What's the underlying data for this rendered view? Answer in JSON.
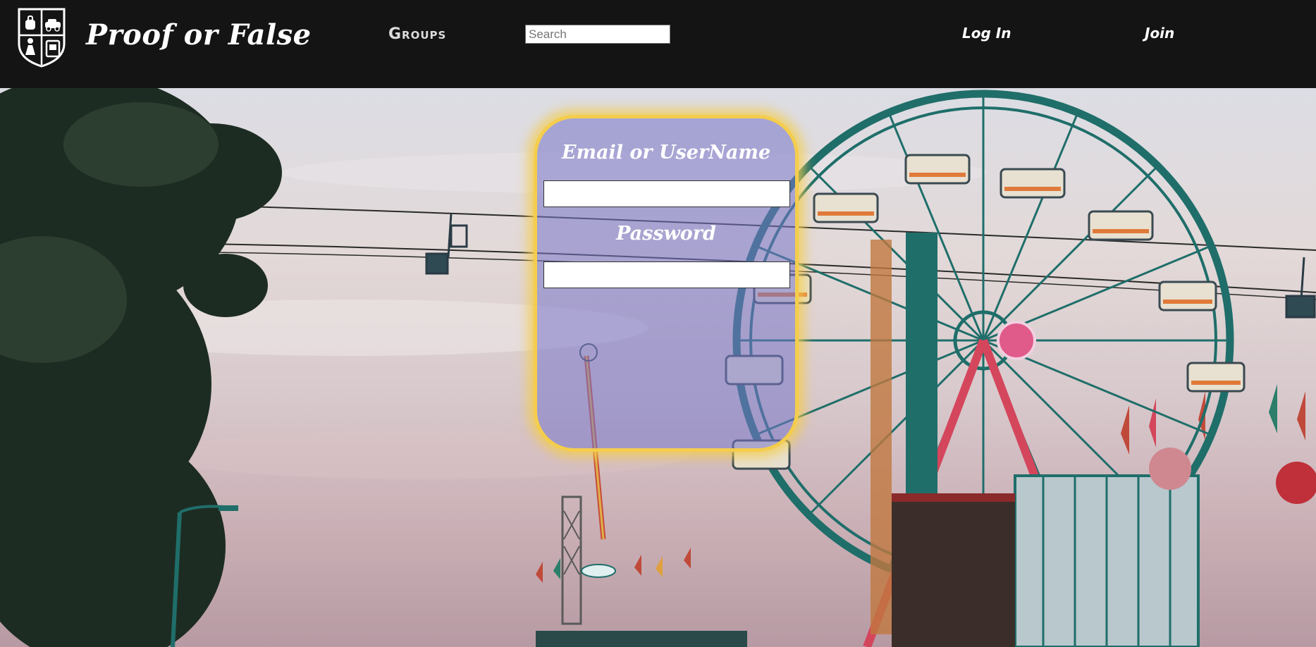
{
  "header": {
    "brand": "Proof or False",
    "nav_groups": "Groups",
    "search_placeholder": "Search",
    "nav_login": "Log In",
    "nav_join": "Join"
  },
  "login_form": {
    "username_label": "Email or UserName",
    "username_value": "",
    "password_label": "Password",
    "password_value": ""
  },
  "colors": {
    "header_bg": "#141414",
    "card_border": "#f4cd4c",
    "card_fill": "#7876c8",
    "ferris_wheel": "#1f6e6a"
  },
  "hero_image": "fairground-ferris-wheel-chairlift-photo"
}
